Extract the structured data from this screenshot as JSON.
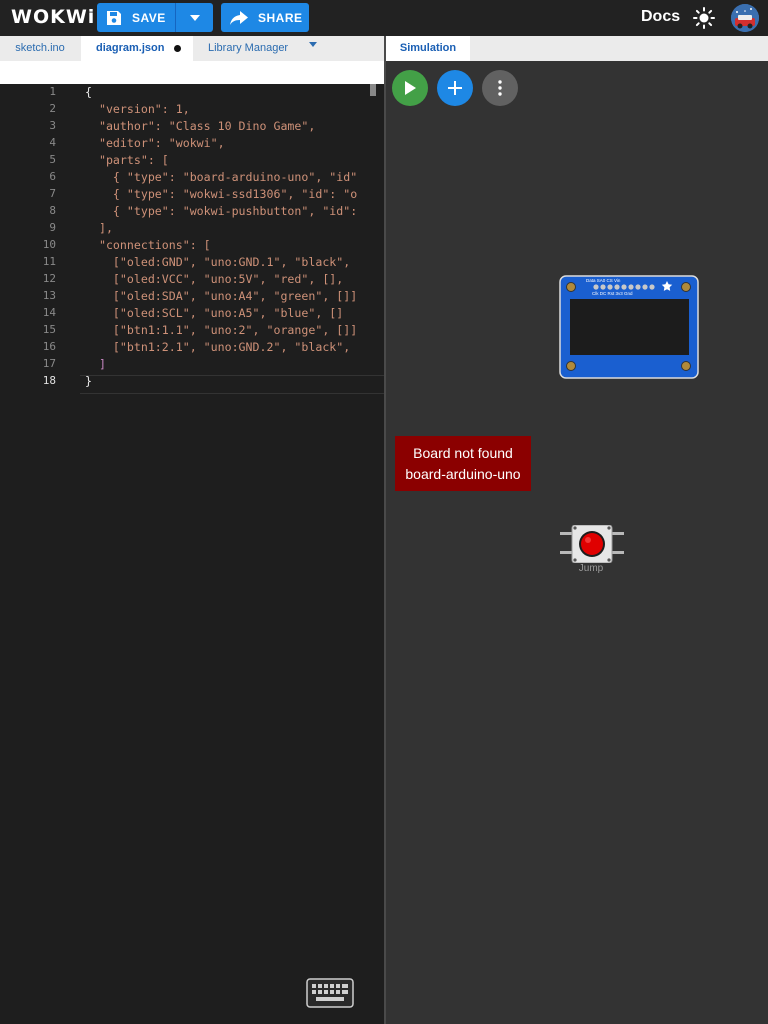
{
  "header": {
    "logo": "WOKWi",
    "save_label": "SAVE",
    "share_label": "SHARE",
    "docs_label": "Docs"
  },
  "tabs": [
    {
      "label": "sketch.ino",
      "active": false,
      "modified": false
    },
    {
      "label": "diagram.json",
      "active": true,
      "modified": true
    },
    {
      "label": "Library Manager",
      "active": false,
      "modified": false
    }
  ],
  "editor": {
    "line_numbers": [
      "1",
      "2",
      "3",
      "4",
      "5",
      "6",
      "7",
      "8",
      "9",
      "10",
      "11",
      "12",
      "13",
      "14",
      "15",
      "16",
      "17",
      "18"
    ],
    "lines": [
      "{",
      "  \"version\": 1,",
      "  \"author\": \"Class 10 Dino Game\",",
      "  \"editor\": \"wokwi\",",
      "  \"parts\": [",
      "    { \"type\": \"board-arduino-uno\", \"id\"",
      "    { \"type\": \"wokwi-ssd1306\", \"id\": \"o",
      "    { \"type\": \"wokwi-pushbutton\", \"id\":",
      "  ],",
      "  \"connections\": [",
      "    [\"oled:GND\", \"uno:GND.1\", \"black\",",
      "    [\"oled:VCC\", \"uno:5V\", \"red\", [],",
      "    [\"oled:SDA\", \"uno:A4\", \"green\", []]",
      "    [\"oled:SCL\", \"uno:A5\", \"blue\", []",
      "    [\"btn1:1.1\", \"uno:2\", \"orange\", []]",
      "    [\"btn1:2.1\", \"uno:GND.2\", \"black\",",
      "  ]",
      "}"
    ]
  },
  "simulation": {
    "tab_label": "Simulation",
    "error_line1": "Board not found",
    "error_line2": "board-arduino-uno",
    "button_label": "Jump",
    "oled_pins_top": [
      "Data",
      "Clk",
      "DC",
      "Rst",
      "CS",
      "3v3",
      "Vin",
      "Gnd"
    ],
    "oled_pin_labels_bottom": "Clk DC Rst  3v3  Gnd",
    "oled_pin_labels_top": "Data  SA0   CS   Vin"
  },
  "colors": {
    "accent": "#1e88e5",
    "play": "#43a047",
    "add": "#1e88e5",
    "more": "#616161",
    "error": "#8b0000",
    "oled_board": "#1a5fd0"
  }
}
